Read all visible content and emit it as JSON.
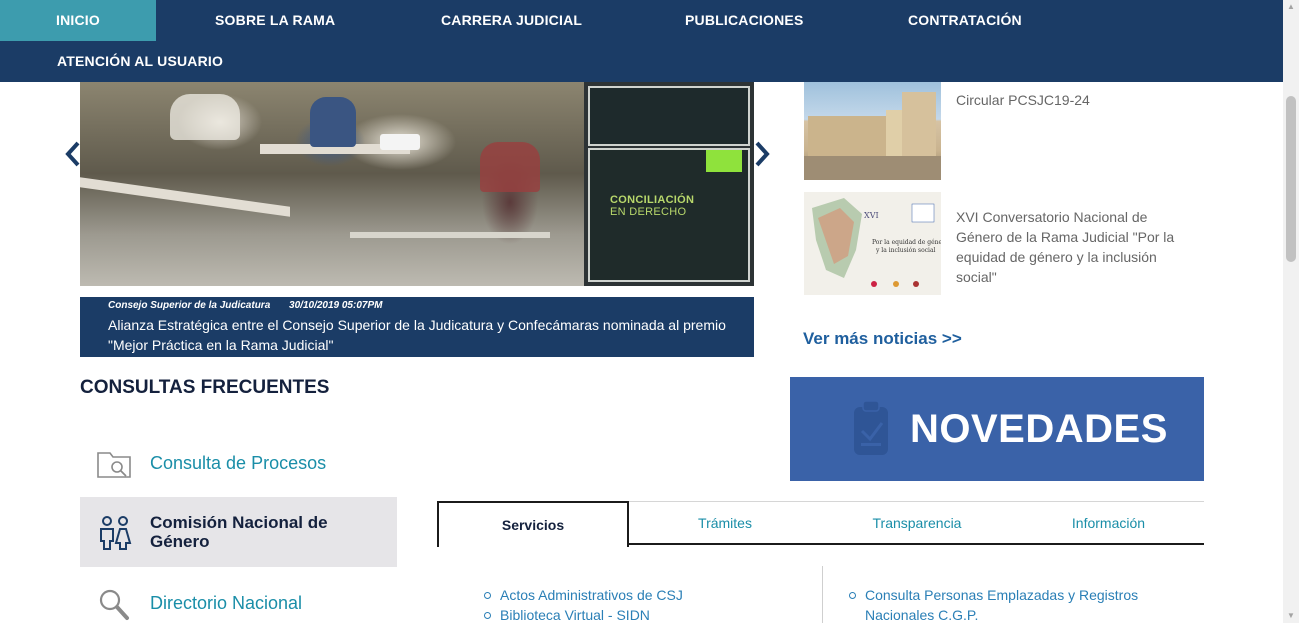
{
  "nav": {
    "items": [
      {
        "label": "INICIO",
        "active": true
      },
      {
        "label": "SOBRE LA RAMA",
        "active": false
      },
      {
        "label": "CARRERA JUDICIAL",
        "active": false
      },
      {
        "label": "PUBLICACIONES",
        "active": false
      },
      {
        "label": "CONTRATACIÓN",
        "active": false
      },
      {
        "label": "ATENCIÓN AL USUARIO",
        "active": false
      }
    ]
  },
  "carousel": {
    "book_title_line1": "CONCILIACIÓN",
    "book_title_line2": "EN DERECHO",
    "prev_icon": "chevron-left-icon",
    "next_icon": "chevron-right-icon",
    "caption": {
      "source": "Consejo Superior de la Judicatura",
      "datetime": "30/10/2019 05:07PM",
      "text": "Alianza Estratégica entre el Consejo Superior de la Judicatura y Confecámaras nominada al premio \"Mejor Práctica en la Rama Judicial\""
    }
  },
  "news": {
    "items": [
      {
        "text": "Circular PCSJC19-24"
      },
      {
        "text": "XVI Conversatorio Nacional de Género de la Rama Judicial \"Por la equidad de género y la inclusión social\""
      }
    ],
    "more_label": "Ver más noticias >>"
  },
  "novedades": {
    "label": "NOVEDADES",
    "icon": "clipboard-icon",
    "color": "#3a62a8"
  },
  "consultas": {
    "title": "CONSULTAS FRECUENTES",
    "items": [
      {
        "label": "Consulta de Procesos",
        "icon": "folder-search-icon"
      },
      {
        "label": "Comisión Nacional de Género",
        "icon": "people-icon"
      },
      {
        "label": "Directorio Nacional",
        "icon": "magnifier-icon"
      }
    ]
  },
  "tabs": {
    "items": [
      {
        "label": "Servicios",
        "active": true
      },
      {
        "label": "Trámites",
        "active": false
      },
      {
        "label": "Transparencia",
        "active": false
      },
      {
        "label": "Información",
        "active": false
      }
    ]
  },
  "servicios": {
    "left": [
      "Actos Administrativos de CSJ",
      "Biblioteca Virtual - SIDN"
    ],
    "right": [
      "Consulta Personas Emplazadas y Registros Nacionales C.G.P."
    ]
  },
  "colors": {
    "nav_bg": "#1b3c66",
    "nav_active": "#3d9cae",
    "link": "#1a8ea8"
  }
}
